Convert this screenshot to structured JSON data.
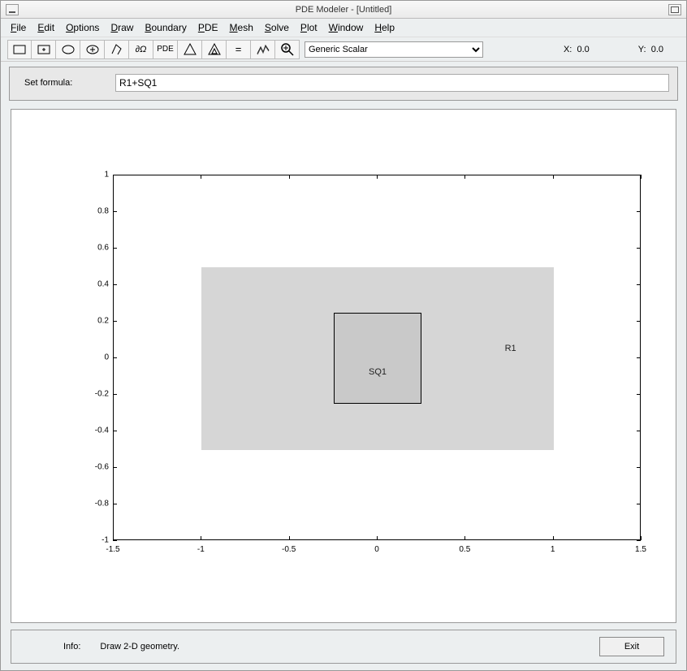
{
  "window": {
    "title": "PDE Modeler - [Untitled]"
  },
  "menu": {
    "items": [
      {
        "u": "F",
        "rest": "ile"
      },
      {
        "u": "E",
        "rest": "dit"
      },
      {
        "u": "O",
        "rest": "ptions"
      },
      {
        "u": "D",
        "rest": "raw"
      },
      {
        "u": "B",
        "rest": "oundary"
      },
      {
        "u": "P",
        "rest": "DE"
      },
      {
        "u": "M",
        "rest": "esh"
      },
      {
        "u": "S",
        "rest": "olve"
      },
      {
        "u": "P",
        "rest": "lot"
      },
      {
        "u": "W",
        "rest": "indow"
      },
      {
        "u": "H",
        "rest": "elp"
      }
    ]
  },
  "toolbar": {
    "boundary_label": "∂Ω",
    "pde_label": "PDE",
    "equals_label": "=",
    "type_options": [
      "Generic Scalar"
    ],
    "type_selected": "Generic Scalar",
    "x_label": "X:",
    "x_val": "0.0",
    "y_label": "Y:",
    "y_val": "0.0"
  },
  "formula": {
    "label": "Set formula:",
    "value": "R1+SQ1"
  },
  "chart_data": {
    "type": "geometry",
    "xlim": [
      -1.5,
      1.5
    ],
    "ylim": [
      -1,
      1
    ],
    "xticks": [
      -1.5,
      -1,
      -0.5,
      0,
      0.5,
      1,
      1.5
    ],
    "yticks": [
      -1,
      -0.8,
      -0.6,
      -0.4,
      -0.2,
      0,
      0.2,
      0.4,
      0.6,
      0.8,
      1
    ],
    "shapes": [
      {
        "name": "R1",
        "type": "rect",
        "x": [
          -1,
          1
        ],
        "y": [
          -0.5,
          0.5
        ]
      },
      {
        "name": "SQ1",
        "type": "rect",
        "x": [
          -0.25,
          0.25
        ],
        "y": [
          -0.25,
          0.25
        ]
      }
    ]
  },
  "status": {
    "info_label": "Info:",
    "message": "Draw 2-D geometry.",
    "exit_label": "Exit"
  }
}
